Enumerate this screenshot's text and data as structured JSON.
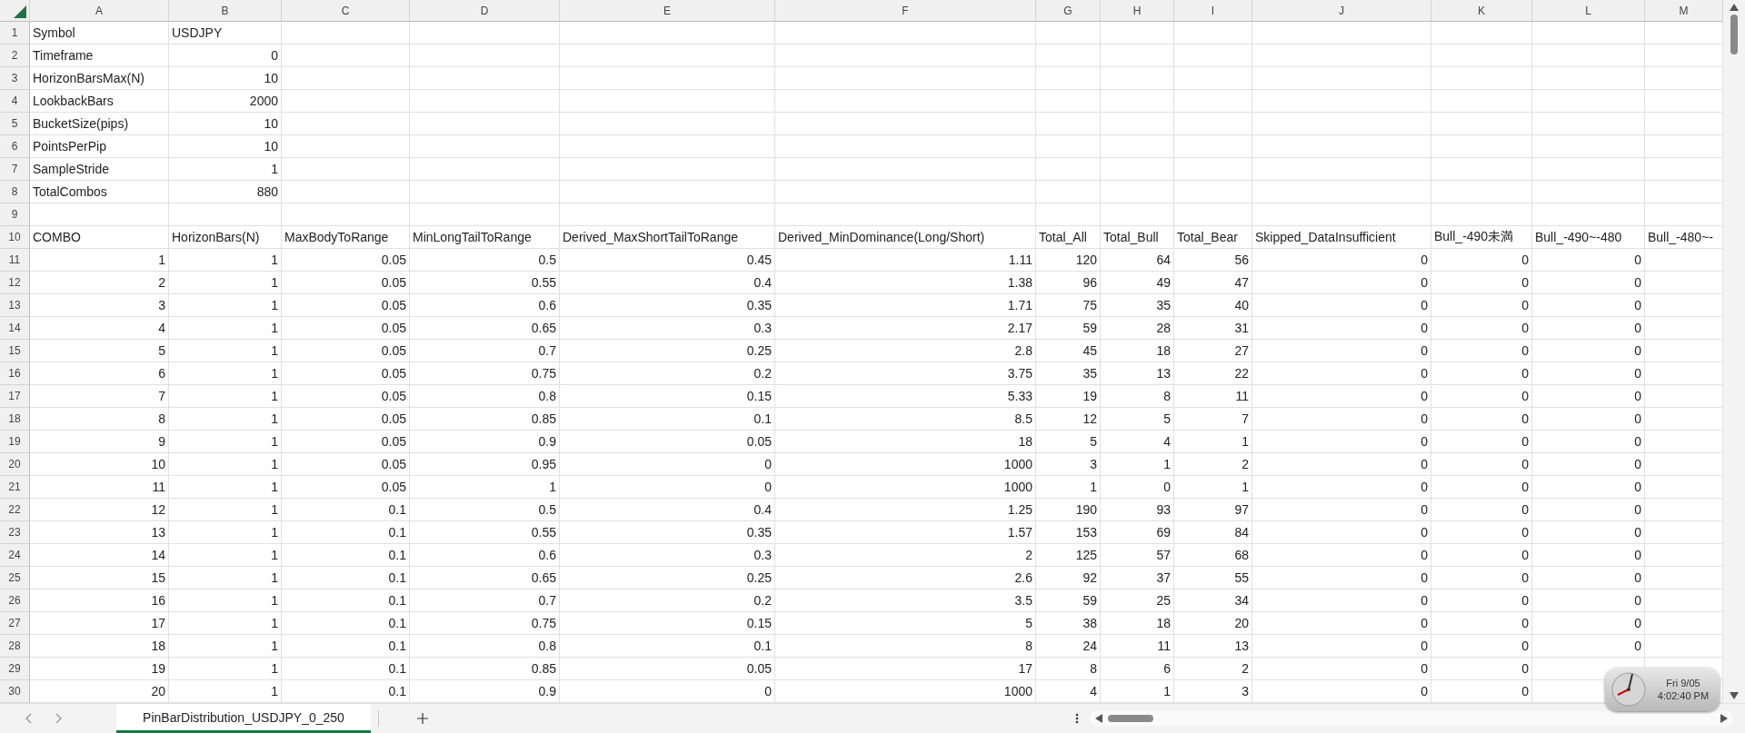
{
  "sheet": {
    "columns": [
      "A",
      "B",
      "C",
      "D",
      "E",
      "F",
      "G",
      "H",
      "I",
      "J",
      "K",
      "L",
      "M"
    ],
    "rows": [
      {
        "number": "1",
        "cells": [
          "Symbol",
          "USDJPY"
        ]
      },
      {
        "number": "2",
        "cells": [
          "Timeframe",
          "0"
        ]
      },
      {
        "number": "3",
        "cells": [
          "HorizonBarsMax(N)",
          "10"
        ]
      },
      {
        "number": "4",
        "cells": [
          "LookbackBars",
          "2000"
        ]
      },
      {
        "number": "5",
        "cells": [
          "BucketSize(pips)",
          "10"
        ]
      },
      {
        "number": "6",
        "cells": [
          "PointsPerPip",
          "10"
        ]
      },
      {
        "number": "7",
        "cells": [
          "SampleStride",
          "1"
        ]
      },
      {
        "number": "8",
        "cells": [
          "TotalCombos",
          "880"
        ]
      },
      {
        "number": "9"
      },
      {
        "number": "10",
        "cells": [
          "COMBO",
          "HorizonBars(N)",
          "MaxBodyToRange",
          "MinLongTailToRange",
          "Derived_MaxShortTailToRange",
          "Derived_MinDominance(Long/Short)",
          "Total_All",
          "Total_Bull",
          "Total_Bear",
          "Skipped_DataInsufficient",
          "Bull_-490未満",
          "Bull_-490~-480",
          "Bull_-480~-"
        ]
      },
      {
        "number": "11",
        "cells": [
          "1",
          "1",
          "0.05",
          "0.5",
          "0.45",
          "1.11",
          "120",
          "64",
          "56",
          "0",
          "0",
          "0"
        ]
      },
      {
        "number": "12",
        "cells": [
          "2",
          "1",
          "0.05",
          "0.55",
          "0.4",
          "1.38",
          "96",
          "49",
          "47",
          "0",
          "0",
          "0"
        ]
      },
      {
        "number": "13",
        "cells": [
          "3",
          "1",
          "0.05",
          "0.6",
          "0.35",
          "1.71",
          "75",
          "35",
          "40",
          "0",
          "0",
          "0"
        ]
      },
      {
        "number": "14",
        "cells": [
          "4",
          "1",
          "0.05",
          "0.65",
          "0.3",
          "2.17",
          "59",
          "28",
          "31",
          "0",
          "0",
          "0"
        ]
      },
      {
        "number": "15",
        "cells": [
          "5",
          "1",
          "0.05",
          "0.7",
          "0.25",
          "2.8",
          "45",
          "18",
          "27",
          "0",
          "0",
          "0"
        ]
      },
      {
        "number": "16",
        "cells": [
          "6",
          "1",
          "0.05",
          "0.75",
          "0.2",
          "3.75",
          "35",
          "13",
          "22",
          "0",
          "0",
          "0"
        ]
      },
      {
        "number": "17",
        "cells": [
          "7",
          "1",
          "0.05",
          "0.8",
          "0.15",
          "5.33",
          "19",
          "8",
          "11",
          "0",
          "0",
          "0"
        ]
      },
      {
        "number": "18",
        "cells": [
          "8",
          "1",
          "0.05",
          "0.85",
          "0.1",
          "8.5",
          "12",
          "5",
          "7",
          "0",
          "0",
          "0"
        ]
      },
      {
        "number": "19",
        "cells": [
          "9",
          "1",
          "0.05",
          "0.9",
          "0.05",
          "18",
          "5",
          "4",
          "1",
          "0",
          "0",
          "0"
        ]
      },
      {
        "number": "20",
        "cells": [
          "10",
          "1",
          "0.05",
          "0.95",
          "0",
          "1000",
          "3",
          "1",
          "2",
          "0",
          "0",
          "0"
        ]
      },
      {
        "number": "21",
        "cells": [
          "11",
          "1",
          "0.05",
          "1",
          "0",
          "1000",
          "1",
          "0",
          "1",
          "0",
          "0",
          "0"
        ]
      },
      {
        "number": "22",
        "cells": [
          "12",
          "1",
          "0.1",
          "0.5",
          "0.4",
          "1.25",
          "190",
          "93",
          "97",
          "0",
          "0",
          "0"
        ]
      },
      {
        "number": "23",
        "cells": [
          "13",
          "1",
          "0.1",
          "0.55",
          "0.35",
          "1.57",
          "153",
          "69",
          "84",
          "0",
          "0",
          "0"
        ]
      },
      {
        "number": "24",
        "cells": [
          "14",
          "1",
          "0.1",
          "0.6",
          "0.3",
          "2",
          "125",
          "57",
          "68",
          "0",
          "0",
          "0"
        ]
      },
      {
        "number": "25",
        "cells": [
          "15",
          "1",
          "0.1",
          "0.65",
          "0.25",
          "2.6",
          "92",
          "37",
          "55",
          "0",
          "0",
          "0"
        ]
      },
      {
        "number": "26",
        "cells": [
          "16",
          "1",
          "0.1",
          "0.7",
          "0.2",
          "3.5",
          "59",
          "25",
          "34",
          "0",
          "0",
          "0"
        ]
      },
      {
        "number": "27",
        "cells": [
          "17",
          "1",
          "0.1",
          "0.75",
          "0.15",
          "5",
          "38",
          "18",
          "20",
          "0",
          "0",
          "0"
        ]
      },
      {
        "number": "28",
        "cells": [
          "18",
          "1",
          "0.1",
          "0.8",
          "0.1",
          "8",
          "24",
          "11",
          "13",
          "0",
          "0",
          "0"
        ]
      },
      {
        "number": "29",
        "cells": [
          "19",
          "1",
          "0.1",
          "0.85",
          "0.05",
          "17",
          "8",
          "6",
          "2",
          "0",
          "0"
        ]
      },
      {
        "number": "30",
        "cells": [
          "20",
          "1",
          "0.1",
          "0.9",
          "0",
          "1000",
          "4",
          "1",
          "3",
          "0",
          "0"
        ]
      }
    ]
  },
  "tabs": [
    {
      "label": "PinBarDistribution_USDJPY_0_250",
      "selected": true
    }
  ],
  "clock": {
    "date": "Fri 9/05",
    "time": "4:02:40 PM"
  }
}
